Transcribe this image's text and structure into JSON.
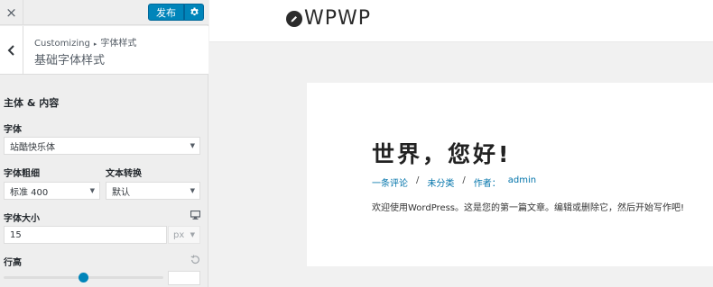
{
  "sidebar": {
    "close_label": "×",
    "publish_label": "发布",
    "breadcrumb": {
      "root": "Customizing",
      "current": "字体样式"
    },
    "section_title": "基础字体样式",
    "group_title": "主体 & 内容",
    "font_family": {
      "label": "字体",
      "value": "站酷快乐体"
    },
    "font_weight": {
      "label": "字体粗细",
      "value": "标准 400"
    },
    "text_transform": {
      "label": "文本转换",
      "value": "默认"
    },
    "font_size": {
      "label": "字体大小",
      "value": "15",
      "unit": "px"
    },
    "line_height": {
      "label": "行高",
      "value": ""
    }
  },
  "preview": {
    "logo_text": "WPWP",
    "post": {
      "title": "世界，您好!",
      "meta": {
        "comments": "一条评论",
        "category": "未分类",
        "author_label": "作者：",
        "author": "admin"
      },
      "excerpt": "欢迎使用WordPress。这是您的第一篇文章。编辑或删除它，然后开始写作吧!"
    }
  },
  "colors": {
    "accent": "#0085ba",
    "link": "#0073aa",
    "panel": "#eeeeee"
  },
  "icons": [
    "close-icon",
    "gear-icon",
    "back-chevron-icon",
    "desktop-device-icon",
    "reset-icon",
    "pencil-icon"
  ]
}
